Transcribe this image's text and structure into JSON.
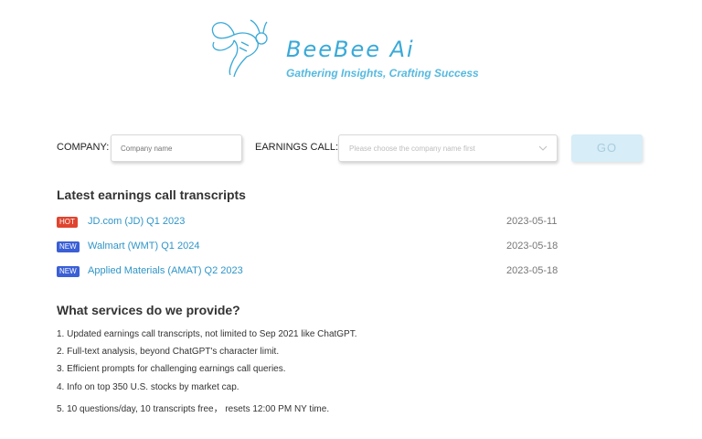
{
  "brand": {
    "title": "BeeBee Ai",
    "tagline": "Gathering Insights, Crafting Success",
    "logo_icon": "bee-icon",
    "accent": "#3aa9d8"
  },
  "form": {
    "company_label": "COMPANY:",
    "company_placeholder": "Company name",
    "earnings_label": "EARNINGS CALL:",
    "earnings_placeholder": "Please choose the company name first",
    "go_label": "GO"
  },
  "transcripts": {
    "title": "Latest earnings call transcripts",
    "items": [
      {
        "badge": "HOT",
        "text": "JD.com (JD) Q1 2023",
        "date": "2023-05-11"
      },
      {
        "badge": "NEW",
        "text": "Walmart (WMT) Q1 2024",
        "date": "2023-05-18"
      },
      {
        "badge": "NEW",
        "text": "Applied Materials (AMAT) Q2 2023",
        "date": "2023-05-18"
      }
    ]
  },
  "services": {
    "title": "What services do we provide?",
    "items": [
      "1. Updated earnings call transcripts, not limited to Sep 2021 like ChatGPT.",
      "2. Full-text analysis, beyond ChatGPT's character limit.",
      "3. Efficient prompts for challenging earnings call queries.",
      "4. Info on top 350 U.S. stocks by market cap.",
      "5. 10 questions/day, 10 transcripts free， resets 12:00 PM NY time."
    ]
  }
}
